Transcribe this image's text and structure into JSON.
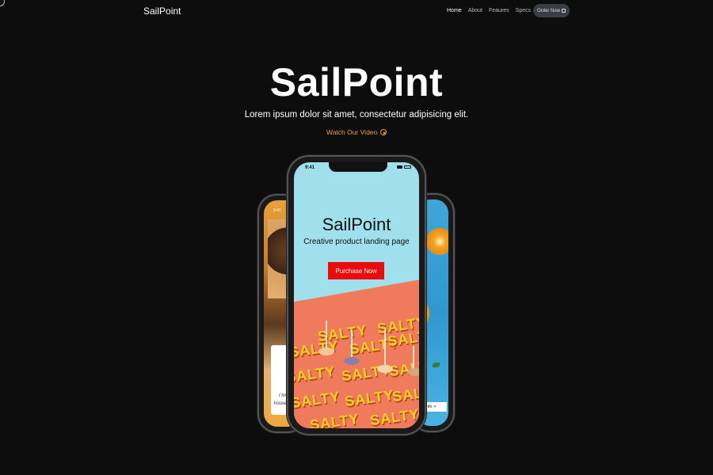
{
  "nav": {
    "brand": "SailPoint",
    "links": [
      "Home",
      "About",
      "Feaures",
      "Specs"
    ],
    "active_link": "Home",
    "order_button": "Order Now",
    "order_icon": "shopping-bag-icon"
  },
  "hero": {
    "title": "SailPoint",
    "subtitle": "Lorem ipsum dolor sit amet, consectetur adipisicing elit.",
    "video_link": "Watch Our Video",
    "video_icon": "play-circle-icon",
    "accent_color": "#e8a23a"
  },
  "phones": {
    "left": {
      "time": "9:41",
      "quote_line1": "I love t",
      "quote_line2": "houses."
    },
    "center": {
      "time": "9:41",
      "title": "SailPoint",
      "subtitle": "Creative product landing page",
      "button": "Purchase Now",
      "button_color": "#ea0c0c",
      "pattern_word": "SALTY"
    },
    "right": {
      "info_button": "re Info >"
    }
  },
  "colors": {
    "background": "#0d0d0d",
    "center_screen": "#9fe0ec",
    "salty_bg": "#ef7a5c"
  }
}
